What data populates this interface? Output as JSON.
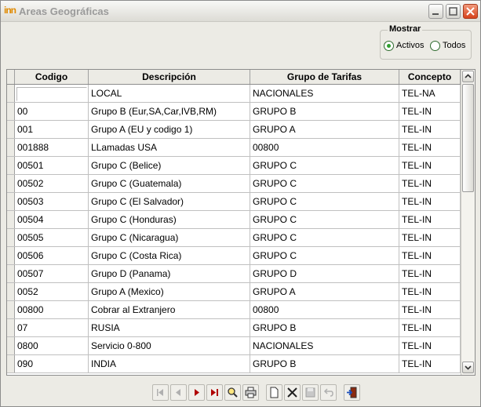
{
  "window": {
    "logo": "inn",
    "title": "Areas Geográficas",
    "buttons": [
      "minimize",
      "maximize",
      "close"
    ]
  },
  "filter": {
    "legend": "Mostrar",
    "options": [
      {
        "label": "Activos",
        "selected": true
      },
      {
        "label": "Todos",
        "selected": false
      }
    ]
  },
  "grid": {
    "columns": [
      "Codigo",
      "Descripción",
      "Grupo de Tarifas",
      "Concepto"
    ],
    "rows": [
      [
        "",
        "LOCAL",
        "NACIONALES",
        "TEL-NA"
      ],
      [
        "00",
        "Grupo B (Eur,SA,Car,IVB,RM)",
        "GRUPO B",
        "TEL-IN"
      ],
      [
        "001",
        "Grupo A (EU y codigo 1)",
        "GRUPO A",
        "TEL-IN"
      ],
      [
        "001888",
        "LLamadas USA",
        "00800",
        "TEL-IN"
      ],
      [
        "00501",
        "Grupo C (Belice)",
        "GRUPO C",
        "TEL-IN"
      ],
      [
        "00502",
        "Grupo C (Guatemala)",
        "GRUPO C",
        "TEL-IN"
      ],
      [
        "00503",
        "Grupo C (El Salvador)",
        "GRUPO C",
        "TEL-IN"
      ],
      [
        "00504",
        "Grupo C (Honduras)",
        "GRUPO C",
        "TEL-IN"
      ],
      [
        "00505",
        "Grupo C (Nicaragua)",
        "GRUPO C",
        "TEL-IN"
      ],
      [
        "00506",
        "Grupo C (Costa Rica)",
        "GRUPO C",
        "TEL-IN"
      ],
      [
        "00507",
        "Grupo D (Panama)",
        "GRUPO D",
        "TEL-IN"
      ],
      [
        "0052",
        "Grupo A (Mexico)",
        "GRUPO A",
        "TEL-IN"
      ],
      [
        "00800",
        "Cobrar al Extranjero",
        "00800",
        "TEL-IN"
      ],
      [
        "07",
        "RUSIA",
        "GRUPO B",
        "TEL-IN"
      ],
      [
        "0800",
        "Servicio 0-800",
        "NACIONALES",
        "TEL-IN"
      ],
      [
        "090",
        "INDIA",
        "GRUPO B",
        "TEL-IN"
      ]
    ]
  },
  "toolbar": {
    "buttons": [
      "first-record",
      "previous-record",
      "next-record",
      "last-record",
      "search",
      "print",
      "new-record",
      "delete-record",
      "save-record",
      "undo",
      "exit"
    ]
  },
  "colors": {
    "window_bg": "#ecebe5",
    "close_button": "#d7421b",
    "radio_selected": "#2fa02f",
    "logo": "#e08a00"
  }
}
